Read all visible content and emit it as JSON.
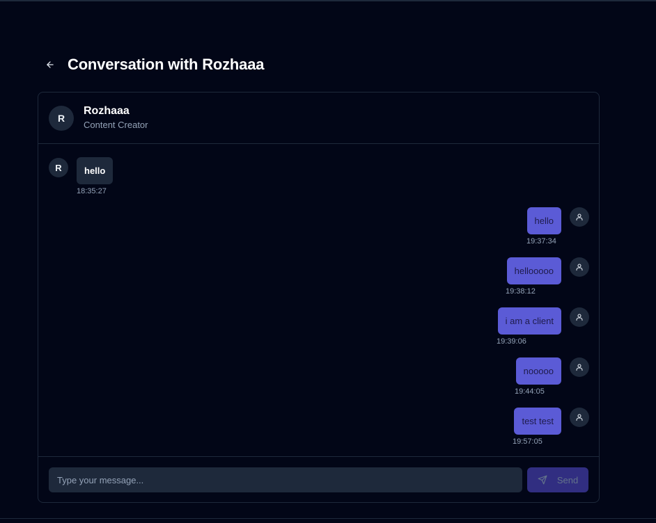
{
  "page": {
    "title": "Conversation with Rozhaaa"
  },
  "contact": {
    "initial": "R",
    "name": "Rozhaaa",
    "role": "Content Creator"
  },
  "messages": [
    {
      "direction": "incoming",
      "sender_initial": "R",
      "text": "hello",
      "time": "18:35:27"
    },
    {
      "direction": "outgoing",
      "text": "hello",
      "time": "19:37:34"
    },
    {
      "direction": "outgoing",
      "text": "hellooooo",
      "time": "19:38:12"
    },
    {
      "direction": "outgoing",
      "text": "i am a client",
      "time": "19:39:06"
    },
    {
      "direction": "outgoing",
      "text": "nooooo",
      "time": "19:44:05"
    },
    {
      "direction": "outgoing",
      "text": "test test",
      "time": "19:57:05"
    }
  ],
  "composer": {
    "placeholder": "Type your message...",
    "value": "",
    "send_label": "Send"
  },
  "icons": {
    "back": "arrow-left-icon",
    "user": "user-icon",
    "send": "send-icon"
  },
  "colors": {
    "background": "#020617",
    "surface": "#1e293b",
    "outgoing_bubble": "#5b5bd6",
    "send_button": "#312e81",
    "muted_text": "#94a3b8"
  }
}
